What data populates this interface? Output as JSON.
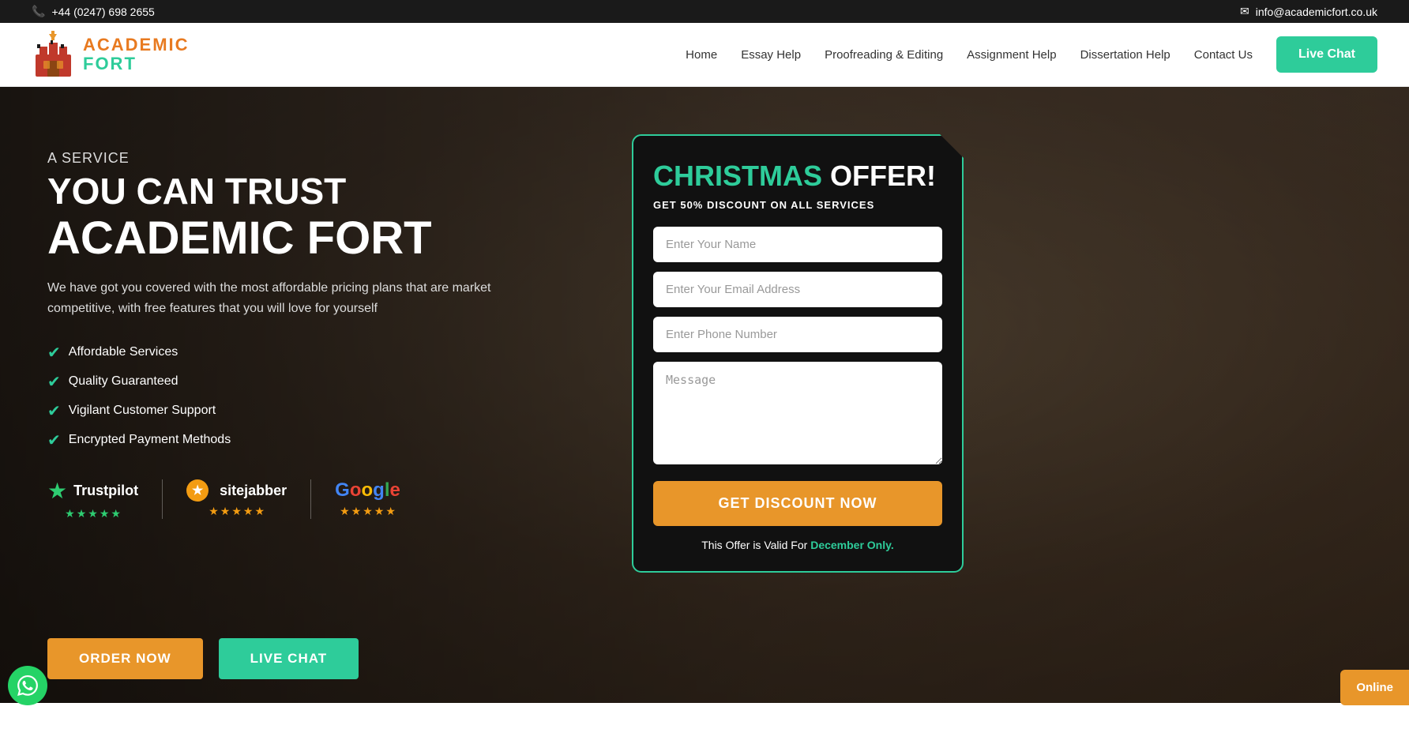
{
  "topbar": {
    "phone": "+44 (0247) 698 2655",
    "email": "info@academicfort.co.uk",
    "phone_icon": "📞",
    "email_icon": "✉"
  },
  "header": {
    "logo_academic": "Academic",
    "logo_fort": "Fort",
    "nav": {
      "home": "Home",
      "essay_help": "Essay Help",
      "proofreading": "Proofreading & Editing",
      "assignment_help": "Assignment Help",
      "dissertation_help": "Dissertation Help",
      "contact_us": "Contact Us"
    },
    "live_chat_btn": "Live Chat"
  },
  "hero": {
    "a_service": "A SERVICE",
    "headline1": "YOU CAN TRUST",
    "headline2": "ACADEMIC FORT",
    "tagline": "We have got you covered with the most affordable pricing plans that are market competitive, with free features that you will love for yourself",
    "features": [
      "Affordable Services",
      "Quality Guaranteed",
      "Vigilant Customer Support",
      "Encrypted Payment Methods"
    ],
    "order_btn": "ORDER NOW",
    "live_chat_btn": "LIVE CHAT"
  },
  "trust": {
    "trustpilot_name": "Trustpilot",
    "sitejabber_name": "sitejabber",
    "google_name": "Google"
  },
  "offer": {
    "christmas": "CHRISTMAS",
    "offer": "OFFER!",
    "subtitle": "GET 50% DISCOUNT ON ALL SERVICES",
    "name_placeholder": "Enter Your Name",
    "email_placeholder": "Enter Your Email Address",
    "phone_placeholder": "Enter Phone Number",
    "message_placeholder": "Message",
    "btn_label": "GET DISCOUNT NOW",
    "validity_text": "This Offer is Valid For",
    "validity_month": "December Only."
  },
  "online": {
    "label": "Online"
  }
}
